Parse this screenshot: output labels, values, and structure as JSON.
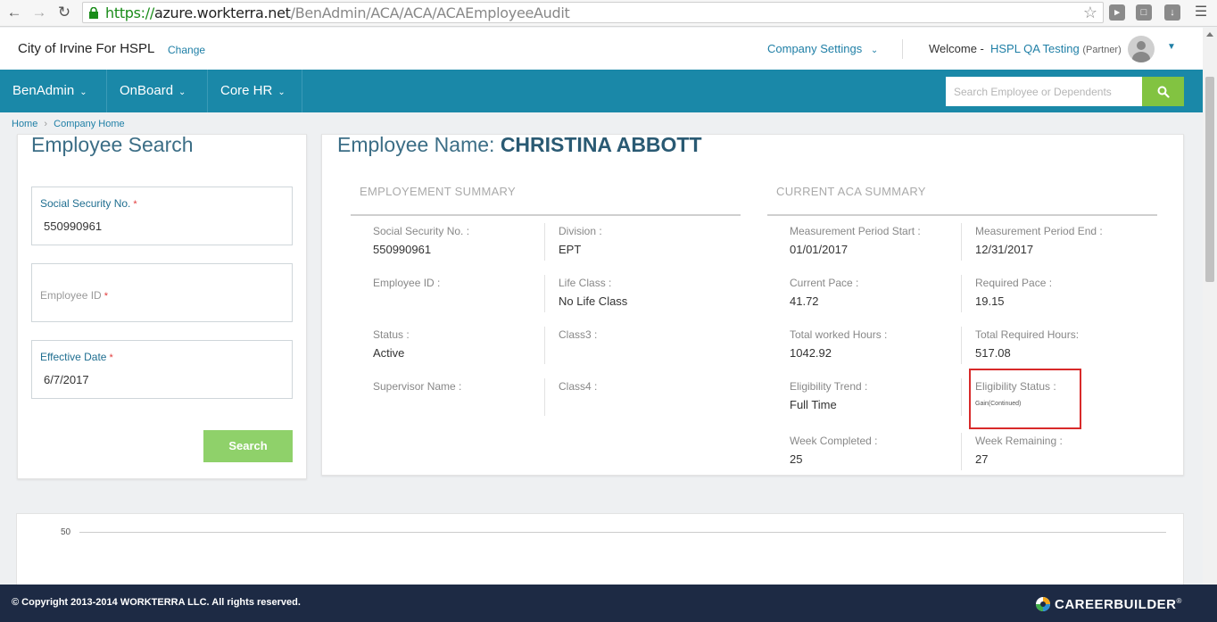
{
  "browser": {
    "url_scheme": "https://",
    "url_host": "azure.workterra.net",
    "url_path": "/BenAdmin/ACA/ACA/ACAEmployeeAudit"
  },
  "header": {
    "company_name": "City of Irvine For HSPL",
    "change_label": "Change",
    "company_settings_label": "Company Settings",
    "welcome_label": "Welcome -",
    "user_name": "HSPL QA Testing",
    "user_role": "(Partner)"
  },
  "nav": {
    "items": [
      {
        "label": "BenAdmin"
      },
      {
        "label": "OnBoard"
      },
      {
        "label": "Core HR"
      }
    ],
    "search_placeholder": "Search Employee or Dependents"
  },
  "breadcrumb": {
    "home": "Home",
    "company_home": "Company Home"
  },
  "employee_search": {
    "title": "Employee Search",
    "ssn_label": "Social Security No.",
    "ssn_value": "550990961",
    "employee_id_label": "Employee ID",
    "employee_id_value": "",
    "effective_date_label": "Effective Date",
    "effective_date_value": "6/7/2017",
    "required_mark": "*",
    "search_button": "Search"
  },
  "employee": {
    "title_prefix": "Employee Name:",
    "name": "CHRISTINA ABBOTT"
  },
  "employment_summary": {
    "title": "EMPLOYEMENT SUMMARY",
    "ssn_label": "Social Security No. :",
    "ssn_value": "550990961",
    "division_label": "Division :",
    "division_value": "EPT",
    "employee_id_label": "Employee ID :",
    "employee_id_value": "",
    "life_class_label": "Life Class :",
    "life_class_value": "No Life Class",
    "status_label": "Status :",
    "status_value": "Active",
    "class3_label": "Class3 :",
    "class3_value": "",
    "supervisor_label": "Supervisor Name :",
    "supervisor_value": "",
    "class4_label": "Class4 :",
    "class4_value": ""
  },
  "aca_summary": {
    "title": "CURRENT ACA SUMMARY",
    "mp_start_label": "Measurement Period Start :",
    "mp_start_value": "01/01/2017",
    "mp_end_label": "Measurement Period End :",
    "mp_end_value": "12/31/2017",
    "current_pace_label": "Current Pace :",
    "current_pace_value": "41.72",
    "required_pace_label": "Required Pace :",
    "required_pace_value": "19.15",
    "total_worked_label": "Total worked Hours :",
    "total_worked_value": "1042.92",
    "total_required_label": "Total Required Hours:",
    "total_required_value": "517.08",
    "eligibility_trend_label": "Eligibility Trend :",
    "eligibility_trend_value": "Full Time",
    "eligibility_status_label": "Eligibility Status :",
    "eligibility_status_value": "Gain(Continued)",
    "week_completed_label": "Week Completed :",
    "week_completed_value": "25",
    "week_remaining_label": "Week Remaining :",
    "week_remaining_value": "27"
  },
  "chart": {
    "tick_top": "50"
  },
  "footer": {
    "copyright": "© Copyright 2013-2014 WORKTERRA LLC. All rights reserved.",
    "brand": "CAREERBUILDER",
    "brand_mark": "®"
  },
  "colors": {
    "nav_bg": "#1a88a8",
    "search_button": "#82c341",
    "footer_bg": "#1d2a44",
    "highlight": "#d82a2a"
  }
}
